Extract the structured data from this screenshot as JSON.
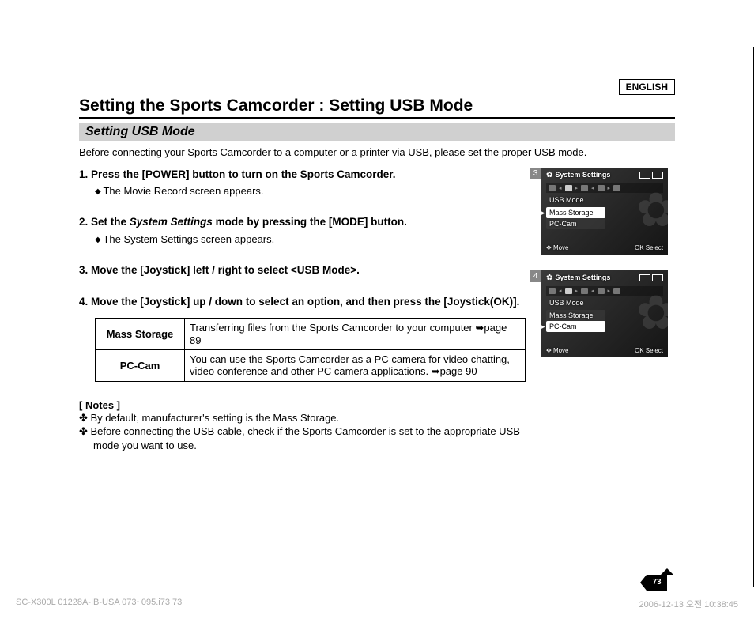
{
  "language_label": "ENGLISH",
  "page_title": "Setting the Sports Camcorder : Setting USB Mode",
  "section_title": "Setting USB Mode",
  "intro": "Before connecting your Sports Camcorder to a computer or a printer via USB, please set the proper USB mode.",
  "steps": [
    {
      "head": "Press the [POWER] button to turn on the Sports Camcorder.",
      "sub": "The Movie Record screen appears."
    },
    {
      "head_pre": "Set the ",
      "head_italic": "System Settings",
      "head_post": " mode by pressing the [MODE] button.",
      "sub": "The System Settings screen appears."
    },
    {
      "head": "Move the [Joystick] left / right to select <USB Mode>."
    },
    {
      "head": "Move the [Joystick] up / down to select an option, and then press the [Joystick(OK)]."
    }
  ],
  "options_table": [
    {
      "key": "Mass Storage",
      "value": "Transferring files from the Sports Camcorder to your computer ➥page 89"
    },
    {
      "key": "PC-Cam",
      "value": "You can use the Sports Camcorder as a PC camera for video chatting, video conference and other PC camera applications. ➥page 90"
    }
  ],
  "notes_header": "[ Notes ]",
  "notes": [
    "By default, manufacturer's setting is the Mass Storage.",
    "Before connecting the USB cable, check if the Sports Camcorder is set to the appropriate USB mode you want to use."
  ],
  "page_number": "73",
  "footer_left": "SC-X300L 01228A-IB-USA 073~095.i73   73",
  "footer_right": "2006-12-13   오전 10:38:45",
  "screenshots": [
    {
      "num": "3",
      "header": "System Settings",
      "mode_label": "USB Mode",
      "options": [
        {
          "label": "Mass Storage",
          "selected": true
        },
        {
          "label": "PC-Cam",
          "selected": false
        }
      ],
      "footer_left": "Move",
      "footer_right": "Select"
    },
    {
      "num": "4",
      "header": "System Settings",
      "mode_label": "USB Mode",
      "options": [
        {
          "label": "Mass Storage",
          "selected": false
        },
        {
          "label": "PC-Cam",
          "selected": true
        }
      ],
      "footer_left": "Move",
      "footer_right": "Select"
    }
  ]
}
